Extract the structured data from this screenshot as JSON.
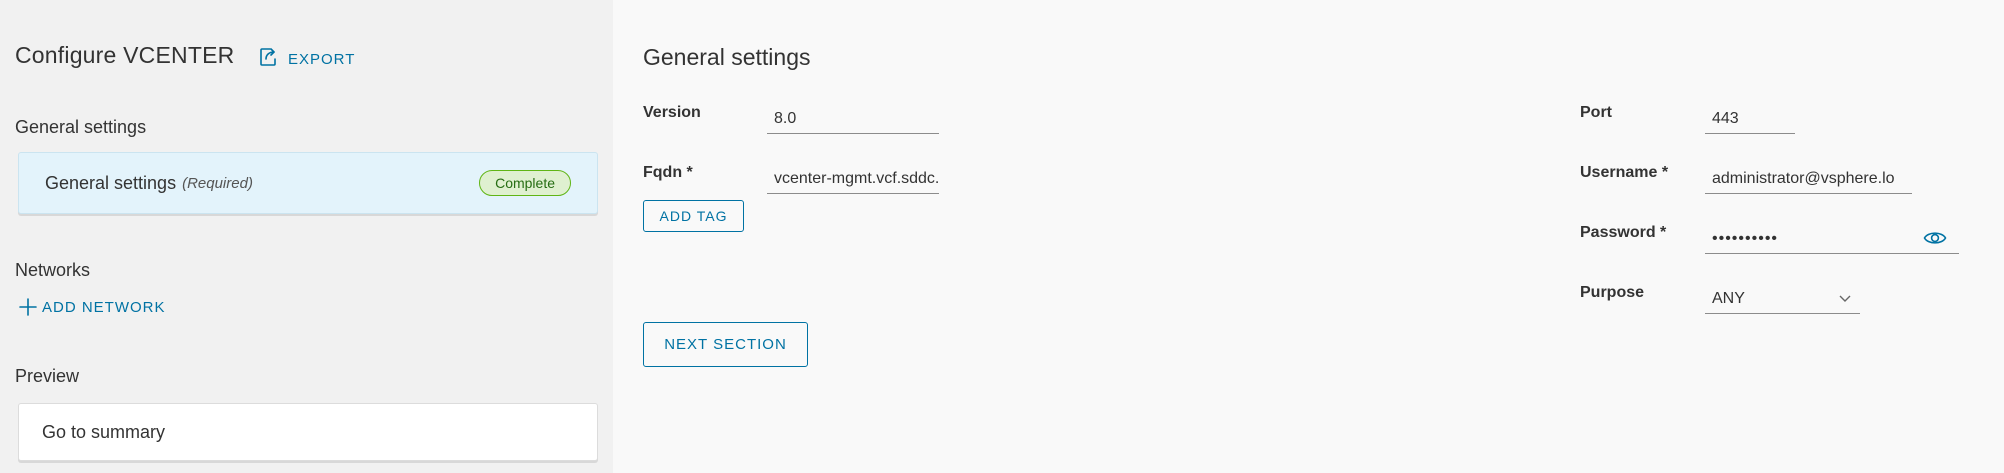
{
  "sidebar": {
    "title": "Configure VCENTER",
    "export_label": "EXPORT",
    "general_heading": "General settings",
    "general_card": {
      "label": "General settings",
      "required": "(Required)",
      "status": "Complete"
    },
    "networks_heading": "Networks",
    "add_network_label": "ADD NETWORK",
    "preview_heading": "Preview",
    "summary_label": "Go to summary"
  },
  "main": {
    "title": "General settings",
    "version": {
      "label": "Version",
      "value": "8.0"
    },
    "fqdn": {
      "label": "Fqdn *",
      "value": "vcenter-mgmt.vcf.sddc.la"
    },
    "add_tag_label": "ADD TAG",
    "next_section_label": "NEXT SECTION",
    "port": {
      "label": "Port",
      "value": "443"
    },
    "username": {
      "label": "Username *",
      "value": "administrator@vsphere.lo"
    },
    "password": {
      "label": "Password *",
      "value": "••••••••••"
    },
    "purpose": {
      "label": "Purpose",
      "value": "ANY"
    }
  },
  "colors": {
    "accent": "#0072a3",
    "sidebar_bg": "#f1f1f1",
    "main_bg": "#f9f9f9",
    "selected_card_bg": "#e3f3fb",
    "badge_bg": "#dff0d0",
    "badge_border": "#60b515",
    "badge_text": "#266d13"
  },
  "icons": {
    "export": "export-icon",
    "add": "plus-icon",
    "password_toggle": "eye-icon",
    "dropdown": "chevron-down-icon"
  }
}
